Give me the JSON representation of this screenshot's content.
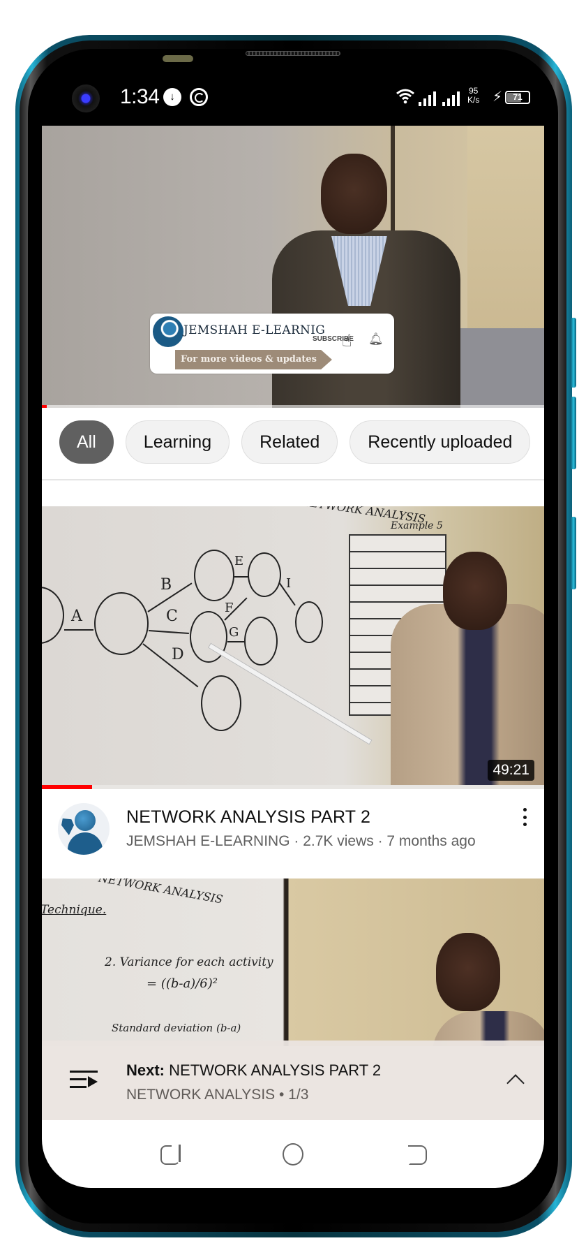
{
  "status_bar": {
    "time": "1:34",
    "download_icon": "download-icon",
    "app_icon": "q-app-icon",
    "network_speed_value": "95",
    "network_speed_unit": "K/s",
    "battery_level": "71",
    "battery_percent": 71
  },
  "player": {
    "banner": {
      "channel_name": "JEMSHAH E-LEARNIG",
      "tagline": "For more videos & updates",
      "subscribe_label": "SUBSCRIBE"
    },
    "progress_percent": 1
  },
  "chips": [
    {
      "label": "All",
      "active": true
    },
    {
      "label": "Learning",
      "active": false
    },
    {
      "label": "Related",
      "active": false
    },
    {
      "label": "Recently uploaded",
      "active": false
    }
  ],
  "videos": [
    {
      "title": "NETWORK ANALYSIS PART 2",
      "meta": "JEMSHAH E-LEARNING · 2.7K views · 7 months ago",
      "duration": "49:21",
      "watched_percent": 10,
      "whiteboard": {
        "heading": "NETWORK ANALYSIS",
        "example": "Example 5",
        "edge_labels": [
          "A",
          "B",
          "C",
          "D",
          "E",
          "F",
          "G",
          "I"
        ]
      }
    },
    {
      "whiteboard": {
        "heading": "NETWORK ANALYSIS",
        "technique": "Technique.",
        "formula_label": "2. Variance for each activity",
        "formula": "= ((b-a)/6)²",
        "next_line": "Standard deviation (b-a)"
      }
    }
  ],
  "playlist_bar": {
    "next_prefix": "Next:",
    "next_title": "NETWORK ANALYSIS PART 2",
    "playlist_info": "NETWORK ANALYSIS • 1/3"
  },
  "colors": {
    "accent_red": "#ff0000",
    "chip_active_bg": "#606060",
    "chip_bg": "#f2f2f2",
    "phone_frame": "#26b4d6"
  }
}
